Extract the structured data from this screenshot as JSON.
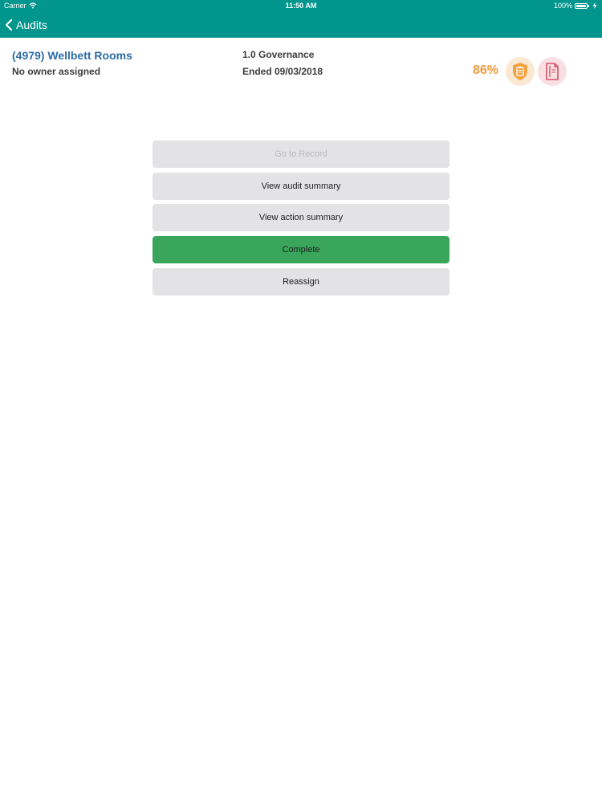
{
  "status_bar": {
    "carrier": "Carrier",
    "time": "11:50 AM",
    "battery": "100%",
    "icons": [
      "wifi-icon",
      "battery-icon",
      "charging-icon"
    ]
  },
  "nav": {
    "back_label": "Audits",
    "back_icon": "chevron-left-icon"
  },
  "audit": {
    "title": "(4979) Wellbett Rooms",
    "owner": "No owner assigned",
    "section": "1.0 Governance",
    "ended": "Ended 09/03/2018",
    "score": "86%",
    "badges": [
      "shield-clipboard-icon",
      "document-icon"
    ]
  },
  "actions": {
    "go_to_record": "Go to Record",
    "view_audit_summary": "View audit summary",
    "view_action_summary": "View action summary",
    "complete": "Complete",
    "reassign": "Reassign"
  },
  "colors": {
    "nav_bar": "#00968d",
    "title": "#2d6ca7",
    "score": "#ef9a3c",
    "complete_button": "#3aa65c",
    "button_bg": "#e3e3e6",
    "disabled_text": "#b9b9bd"
  }
}
